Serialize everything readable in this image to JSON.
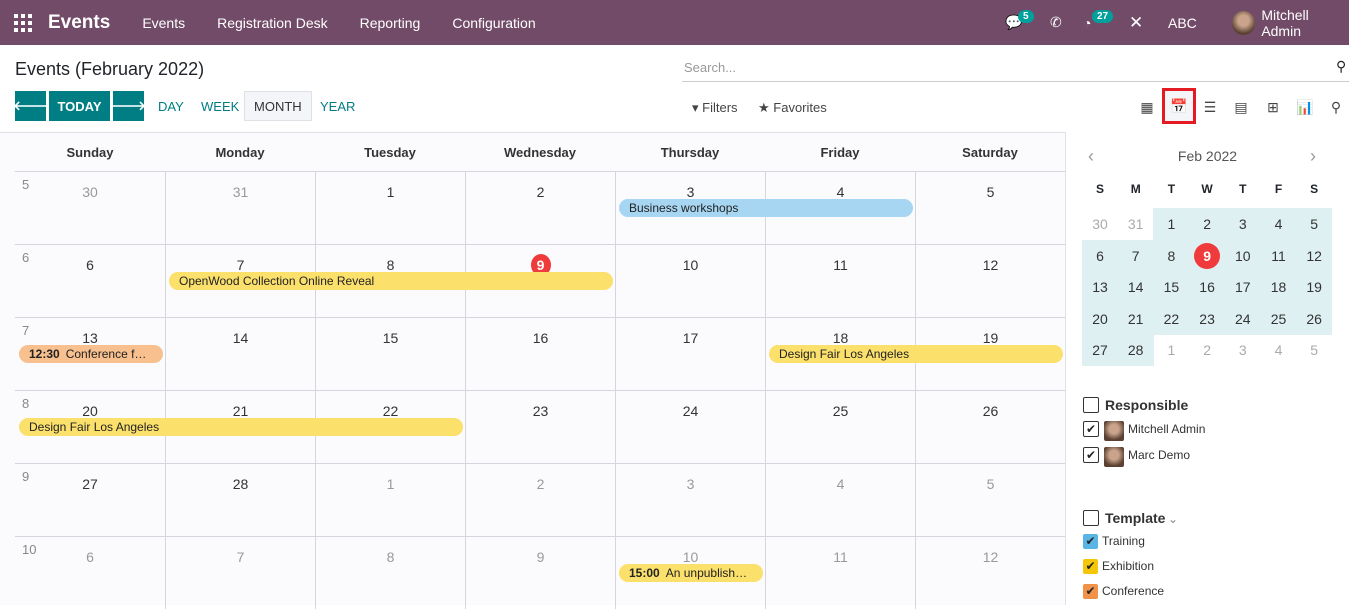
{
  "nav": {
    "brand": "Events",
    "menu": [
      "Events",
      "Registration Desk",
      "Reporting",
      "Configuration"
    ],
    "messages_count": "5",
    "activities_count": "27",
    "company": "ABC",
    "user": "Mitchell Admin",
    "color": "#714b67"
  },
  "control": {
    "title": "Events (February 2022)",
    "search_placeholder": "Search...",
    "today": "TODAY",
    "scales": [
      "DAY",
      "WEEK",
      "MONTH",
      "YEAR"
    ],
    "active_scale": "MONTH",
    "filters": "Filters",
    "favorites": "Favorites",
    "views": [
      "kanban-icon",
      "calendar-icon",
      "list-icon",
      "gantt-icon",
      "pivot-icon",
      "graph-icon",
      "map-icon"
    ],
    "active_view": "calendar-icon"
  },
  "calendar": {
    "weekdays": [
      "Sunday",
      "Monday",
      "Tuesday",
      "Wednesday",
      "Thursday",
      "Friday",
      "Saturday"
    ],
    "weeks": [
      {
        "num": "5",
        "days": [
          "30",
          "31",
          "1",
          "2",
          "3",
          "4",
          "5"
        ]
      },
      {
        "num": "6",
        "days": [
          "6",
          "7",
          "8",
          "9",
          "10",
          "11",
          "12"
        ]
      },
      {
        "num": "7",
        "days": [
          "13",
          "14",
          "15",
          "16",
          "17",
          "18",
          "19"
        ]
      },
      {
        "num": "8",
        "days": [
          "20",
          "21",
          "22",
          "23",
          "24",
          "25",
          "26"
        ]
      },
      {
        "num": "9",
        "days": [
          "27",
          "28",
          "1",
          "2",
          "3",
          "4",
          "5"
        ]
      },
      {
        "num": "10",
        "days": [
          "6",
          "7",
          "8",
          "9",
          "10",
          "11",
          "12"
        ]
      }
    ],
    "today": "9",
    "events": [
      {
        "title": "Business workshops",
        "time": "",
        "week": 0,
        "start": 4,
        "end": 5,
        "color": "#a6d6f2"
      },
      {
        "title": "OpenWood Collection Online Reveal",
        "time": "",
        "week": 1,
        "start": 1,
        "end": 3,
        "color": "#fbe06b"
      },
      {
        "title": "Conference for ...",
        "time": "12:30",
        "week": 2,
        "start": 0,
        "end": 0,
        "color": "#f7c08e"
      },
      {
        "title": "Design Fair Los Angeles",
        "time": "",
        "week": 2,
        "start": 5,
        "end": 6,
        "color": "#fbe06b"
      },
      {
        "title": "Design Fair Los Angeles",
        "time": "",
        "week": 3,
        "start": 0,
        "end": 2,
        "color": "#fbe06b"
      },
      {
        "title": "An unpublished...",
        "time": "15:00",
        "week": 5,
        "start": 4,
        "end": 4,
        "color": "#fbe06b"
      }
    ]
  },
  "sidebar": {
    "month": "Feb 2022",
    "weekdays": [
      "S",
      "M",
      "T",
      "W",
      "T",
      "F",
      "S"
    ],
    "days": [
      [
        "30",
        "31",
        "1",
        "2",
        "3",
        "4",
        "5"
      ],
      [
        "6",
        "7",
        "8",
        "9",
        "10",
        "11",
        "12"
      ],
      [
        "13",
        "14",
        "15",
        "16",
        "17",
        "18",
        "19"
      ],
      [
        "20",
        "21",
        "22",
        "23",
        "24",
        "25",
        "26"
      ],
      [
        "27",
        "28",
        "1",
        "2",
        "3",
        "4",
        "5"
      ]
    ],
    "responsible": {
      "label": "Responsible",
      "items": [
        "Mitchell Admin",
        "Marc Demo"
      ]
    },
    "template": {
      "label": "Template",
      "items": [
        {
          "label": "Training",
          "color": "#5ab4e5"
        },
        {
          "label": "Exhibition",
          "color": "#f4c609"
        },
        {
          "label": "Conference",
          "color": "#f0924a"
        }
      ]
    }
  }
}
